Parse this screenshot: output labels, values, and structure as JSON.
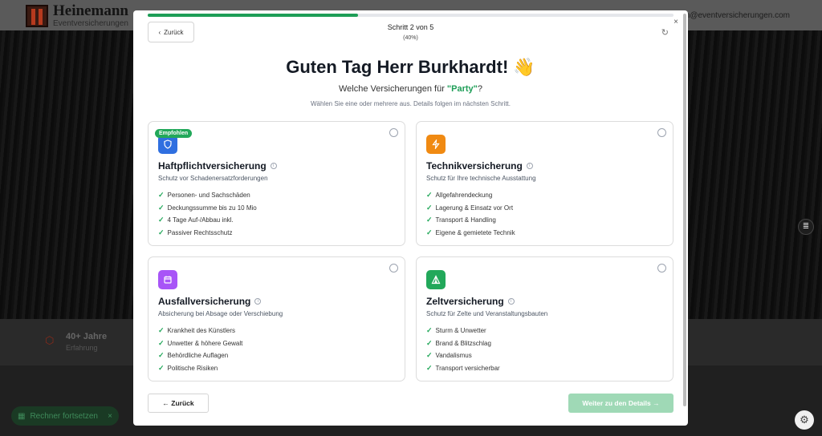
{
  "background": {
    "logo": {
      "name": "Heinemann",
      "sub": "Eventversicherungen"
    },
    "email": "tim@eventversicherungen.com",
    "stat": {
      "value": "40+ Jahre",
      "label": "Erfahrung"
    },
    "pill": {
      "label": "Rechner fortsetzen",
      "close": "×"
    },
    "float_icon": "list-icon",
    "settings_icon": "gear-icon"
  },
  "wizard": {
    "back_top": "Zurück",
    "step_label": "Schritt 2 von 5",
    "step_percent": "(40%)",
    "progress_percent": 40,
    "close": "×",
    "reset": "↻",
    "headline": "Guten Tag Herr Burkhardt! 👋",
    "question_prefix": "Welche Versicherungen für ",
    "event_name": "\"Party\"",
    "question_suffix": "?",
    "hint": "Wählen Sie eine oder mehrere aus. Details folgen im nächsten Schritt.",
    "back_bottom": "← Zurück",
    "next": "Weiter zu den Details →"
  },
  "cards": [
    {
      "badge": "Empfohlen",
      "icon": "shield-icon",
      "icon_color": "#2f6fe0",
      "title": "Haftpflichtversicherung",
      "description": "Schutz vor Schadenersatzforderungen",
      "features": [
        "Personen- und Sachschäden",
        "Deckungssumme bis zu 10 Mio",
        "4 Tage Auf-/Abbau inkl.",
        "Passiver Rechtsschutz"
      ]
    },
    {
      "icon": "lightning-icon",
      "icon_color": "#f08a12",
      "title": "Technikversicherung",
      "description": "Schutz für Ihre technische Ausstattung",
      "features": [
        "Allgefahrendeckung",
        "Lagerung & Einsatz vor Ort",
        "Transport & Handling",
        "Eigene & gemietete Technik"
      ]
    },
    {
      "icon": "calendar-icon",
      "icon_color": "#a855f7",
      "title": "Ausfallversicherung",
      "description": "Absicherung bei Absage oder Verschiebung",
      "features": [
        "Krankheit des Künstlers",
        "Unwetter & höhere Gewalt",
        "Behördliche Auflagen",
        "Politische Risiken"
      ]
    },
    {
      "icon": "tent-icon",
      "icon_color": "#22a85a",
      "title": "Zeltversicherung",
      "description": "Schutz für Zelte und Veranstaltungsbauten",
      "features": [
        "Sturm & Unwetter",
        "Brand & Blitzschlag",
        "Vandalismus",
        "Transport versicherbar"
      ]
    }
  ]
}
